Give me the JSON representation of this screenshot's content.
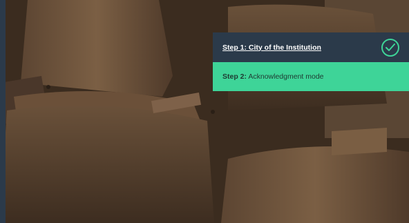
{
  "background": {
    "image_description": "wooden_auditorium_chairs"
  },
  "steps": [
    {
      "label": "Step 1: City of the Institution",
      "state": "completed",
      "icon": "check-circle-icon"
    },
    {
      "prefix": "Step 2:",
      "text": "Acknowledgment mode",
      "state": "current"
    }
  ],
  "colors": {
    "panel_dark": "#2b3a4a",
    "accent_green": "#3ed498"
  }
}
